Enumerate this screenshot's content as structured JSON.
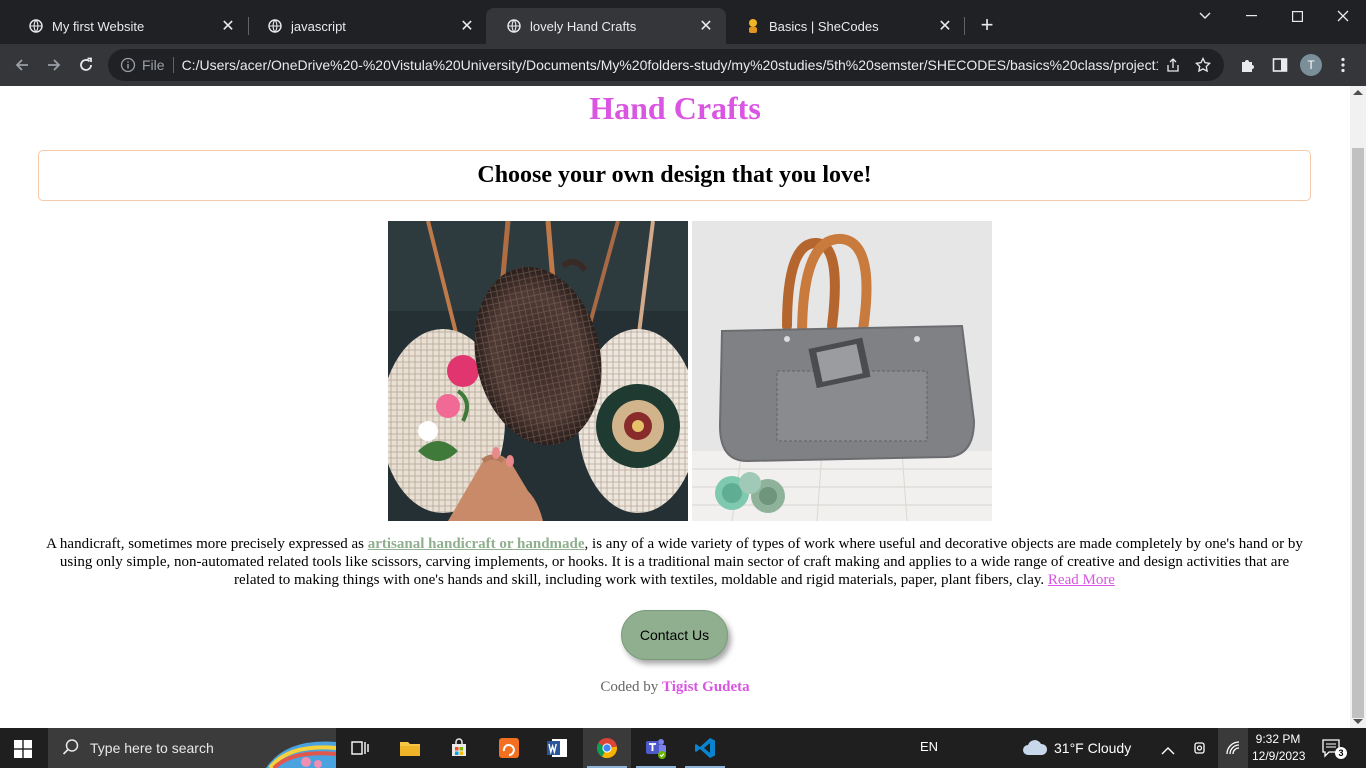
{
  "browser": {
    "tabs": [
      {
        "title": "My first Website",
        "active": false
      },
      {
        "title": "javascript",
        "active": false
      },
      {
        "title": "lovely Hand Crafts",
        "active": true
      },
      {
        "title": "Basics | SheCodes",
        "active": false
      }
    ],
    "scheme_label": "File",
    "url": "C:/Users/acer/OneDrive%20-%20Vistula%20University/Documents/My%20folders-study/my%20studies/5th%20semster/SHECODES/basics%20class/project1....",
    "profile_initial": "T"
  },
  "page": {
    "title": "Hand Crafts",
    "subtitle": "Choose your own design that you love!",
    "description": {
      "before": "A handicraft, sometimes more precisely expressed as ",
      "link": "artisanal handicraft or handmade",
      "after": ", is any of a wide variety of types of work where useful and decorative objects are made completely by one's hand or by using only simple, non-automated related tools like scissors, carving implements, or hooks. It is a traditional main sector of craft making and applies to a wide range of creative and design activities that are related to making things with one's hands and skill, including work with textiles, moldable and rigid materials, paper, plant fibers, clay. ",
      "read_more": "Read More"
    },
    "contact_button": "Contact Us",
    "footer": {
      "prefix": "Coded by ",
      "author": "Tigist Gudeta"
    },
    "colors": {
      "accent": "#d955e2",
      "sage": "#8faf8f",
      "banner_border": "#f6c9a8"
    }
  },
  "taskbar": {
    "search_placeholder": "Type here to search",
    "language": "EN",
    "weather": "31°F  Cloudy",
    "time": "9:32 PM",
    "date": "12/9/2023",
    "notification_count": "3",
    "apps": [
      "task-view",
      "file-explorer",
      "microsoft-store",
      "pdf-reader",
      "word",
      "chrome",
      "teams",
      "vscode"
    ]
  }
}
